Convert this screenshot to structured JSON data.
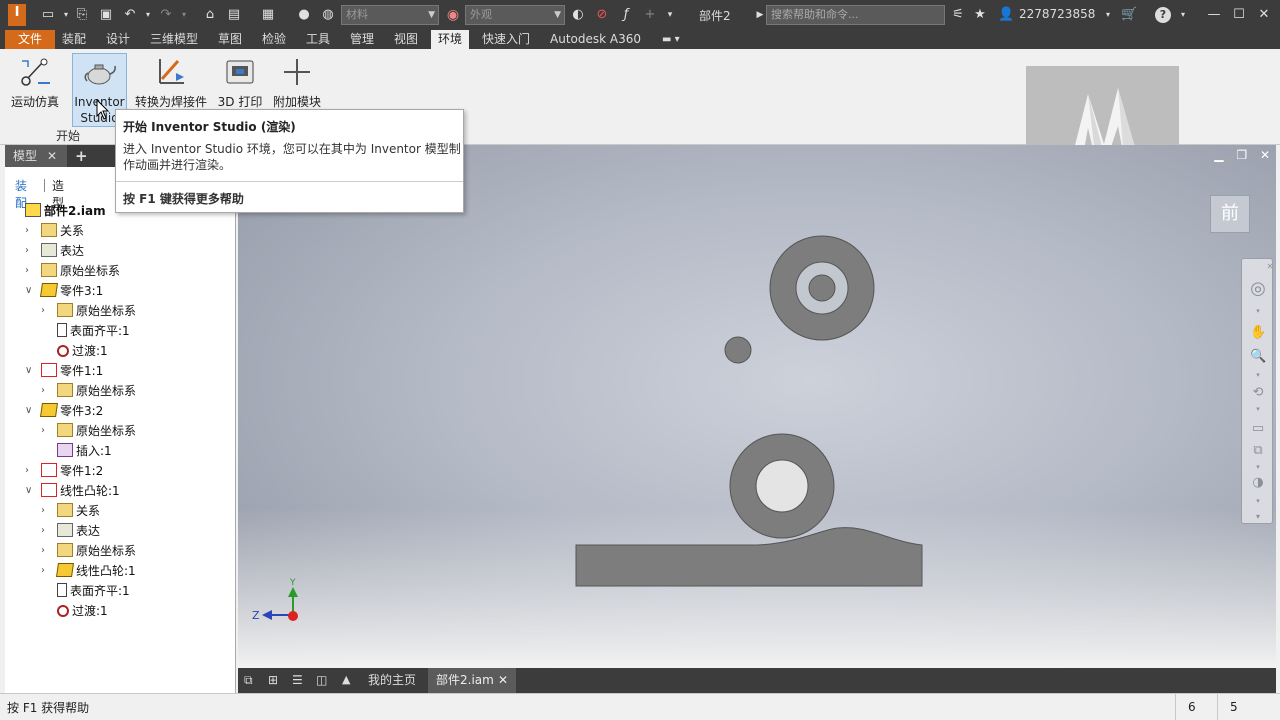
{
  "titlebar": {
    "app_icon": "inventor-pro-icon",
    "material_combo": "材料",
    "appearance_combo": "外观",
    "doc_title": "部件2",
    "search_placeholder": "搜索帮助和命令...",
    "user_name": "2278723858",
    "help_label": "?"
  },
  "menubar": {
    "items": [
      "文件",
      "装配",
      "设计",
      "三维模型",
      "草图",
      "检验",
      "工具",
      "管理",
      "视图",
      "环境",
      "快速入门",
      "Autodesk A360"
    ],
    "active": "环境"
  },
  "ribbon": {
    "buttons": [
      {
        "label": "运动仿真",
        "icon": "dynamic-simulation-icon"
      },
      {
        "label": "Inventor Studio",
        "icon": "teapot-icon"
      },
      {
        "label": "转换为焊接件",
        "icon": "weldment-icon"
      },
      {
        "label": "3D 打印",
        "icon": "printer-icon"
      },
      {
        "label": "附加模块",
        "icon": "plus-icon"
      }
    ],
    "panel_label": "开始"
  },
  "tooltip": {
    "title": "开始 Inventor Studio (渲染)",
    "body": "进入 Inventor Studio 环境，您可以在其中为 Inventor 模型制作动画并进行渲染。",
    "footer": "按 F1 键获得更多帮助"
  },
  "browser": {
    "tab_label": "模型",
    "subtabs": [
      "装配",
      "造型"
    ],
    "tree": [
      {
        "label": "部件2.iam",
        "level": 0,
        "icon": "asm",
        "bold": true
      },
      {
        "label": "关系",
        "level": 1,
        "icon": "folder"
      },
      {
        "label": "表达",
        "level": 1,
        "icon": "repr"
      },
      {
        "label": "原始坐标系",
        "level": 1,
        "icon": "folder"
      },
      {
        "label": "零件3:1",
        "level": 1,
        "icon": "part"
      },
      {
        "label": "原始坐标系",
        "level": 2,
        "icon": "folder"
      },
      {
        "label": "表面齐平:1",
        "level": 2,
        "icon": "flush"
      },
      {
        "label": "过渡:1",
        "level": 2,
        "icon": "trans"
      },
      {
        "label": "零件1:1",
        "level": 1,
        "icon": "cam"
      },
      {
        "label": "原始坐标系",
        "level": 2,
        "icon": "folder"
      },
      {
        "label": "零件3:2",
        "level": 1,
        "icon": "part"
      },
      {
        "label": "原始坐标系",
        "level": 2,
        "icon": "folder"
      },
      {
        "label": "插入:1",
        "level": 2,
        "icon": "insert"
      },
      {
        "label": "零件1:2",
        "level": 1,
        "icon": "cam"
      },
      {
        "label": "线性凸轮:1",
        "level": 1,
        "icon": "cam"
      },
      {
        "label": "关系",
        "level": 2,
        "icon": "folder"
      },
      {
        "label": "表达",
        "level": 2,
        "icon": "repr"
      },
      {
        "label": "原始坐标系",
        "level": 2,
        "icon": "folder"
      },
      {
        "label": "线性凸轮:1",
        "level": 2,
        "icon": "part"
      },
      {
        "label": "表面齐平:1",
        "level": 2,
        "icon": "flush"
      },
      {
        "label": "过渡:1",
        "level": 2,
        "icon": "trans"
      }
    ]
  },
  "viewport": {
    "viewcube_label": "前",
    "axis_labels": [
      "Y",
      "Z"
    ]
  },
  "doctabs": {
    "home": "我的主页",
    "active": "部件2.iam"
  },
  "statusbar": {
    "text": "按 F1 获得帮助",
    "num1": "6",
    "num2": "5"
  },
  "colors": {
    "accent": "#d66a1b",
    "part_gray": "#7d7d7d",
    "dark_ui": "#3c3c3c"
  }
}
